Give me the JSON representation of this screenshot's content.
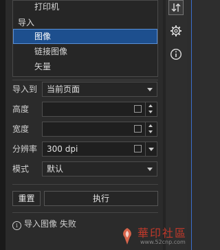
{
  "list": {
    "items": [
      {
        "label": "打印机",
        "kind": "indent"
      },
      {
        "label": "导入",
        "kind": "group"
      },
      {
        "label": "图像",
        "kind": "selected"
      },
      {
        "label": "链接图像",
        "kind": "indent"
      },
      {
        "label": "矢量",
        "kind": "indent"
      }
    ]
  },
  "form": {
    "import_to": {
      "label": "导入到",
      "value": "当前页面"
    },
    "height": {
      "label": "高度",
      "value": ""
    },
    "width": {
      "label": "宽度",
      "value": ""
    },
    "resolution": {
      "label": "分辨率",
      "value": "300 dpi"
    },
    "mode": {
      "label": "模式",
      "value": "默认"
    }
  },
  "buttons": {
    "reset": "重置",
    "execute": "执行"
  },
  "status": {
    "icon": "i",
    "text": "导入图像 失败"
  },
  "watermark": {
    "text": "華印社區",
    "url": "www.52cnp.com"
  },
  "colors": {
    "selection": "#1d4f8e",
    "accent": "#3a6fcf",
    "watermark": "#c0392b"
  }
}
